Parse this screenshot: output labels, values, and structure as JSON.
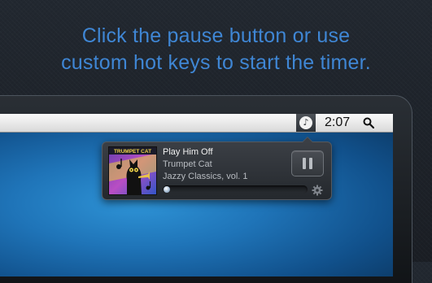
{
  "headline": {
    "line1": "Click the pause button or use",
    "line2": "custom hot keys to start the timer."
  },
  "menubar": {
    "app_icon": "music-note-icon",
    "app_icon_glyph": "♪",
    "time": "2:07",
    "search_icon": "search-icon"
  },
  "player": {
    "track_title": "Play Him Off",
    "artist": "Trumpet Cat",
    "album": "Jazzy Classics, vol. 1",
    "album_art_text": "TRUMPET CAT",
    "progress_fraction": 0.0,
    "pause_icon": "pause-icon",
    "settings_icon": "gear-icon"
  },
  "colors": {
    "headline": "#3f86d4",
    "background": "#1c2127",
    "desktop": "#1f74b8"
  }
}
